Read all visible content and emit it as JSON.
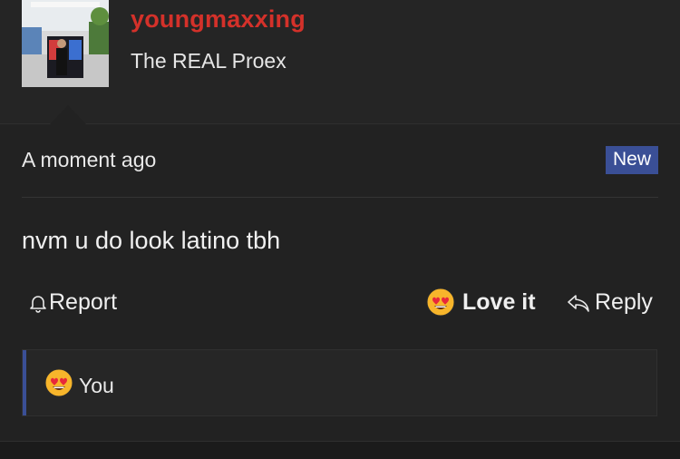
{
  "author": {
    "username": "youngmaxxing",
    "title": "The REAL Proex"
  },
  "post": {
    "timestamp": "A moment ago",
    "badge": "New",
    "message": "nvm u do look latino tbh"
  },
  "actions": {
    "report_label": "Report",
    "love_label": "Love it",
    "reply_label": "Reply"
  },
  "reactions": {
    "reactor": "You",
    "icon": "heart-eyes-emoji"
  },
  "colors": {
    "username": "#d4312a",
    "badge": "#3a4f96",
    "background": "#1b1b1b"
  }
}
